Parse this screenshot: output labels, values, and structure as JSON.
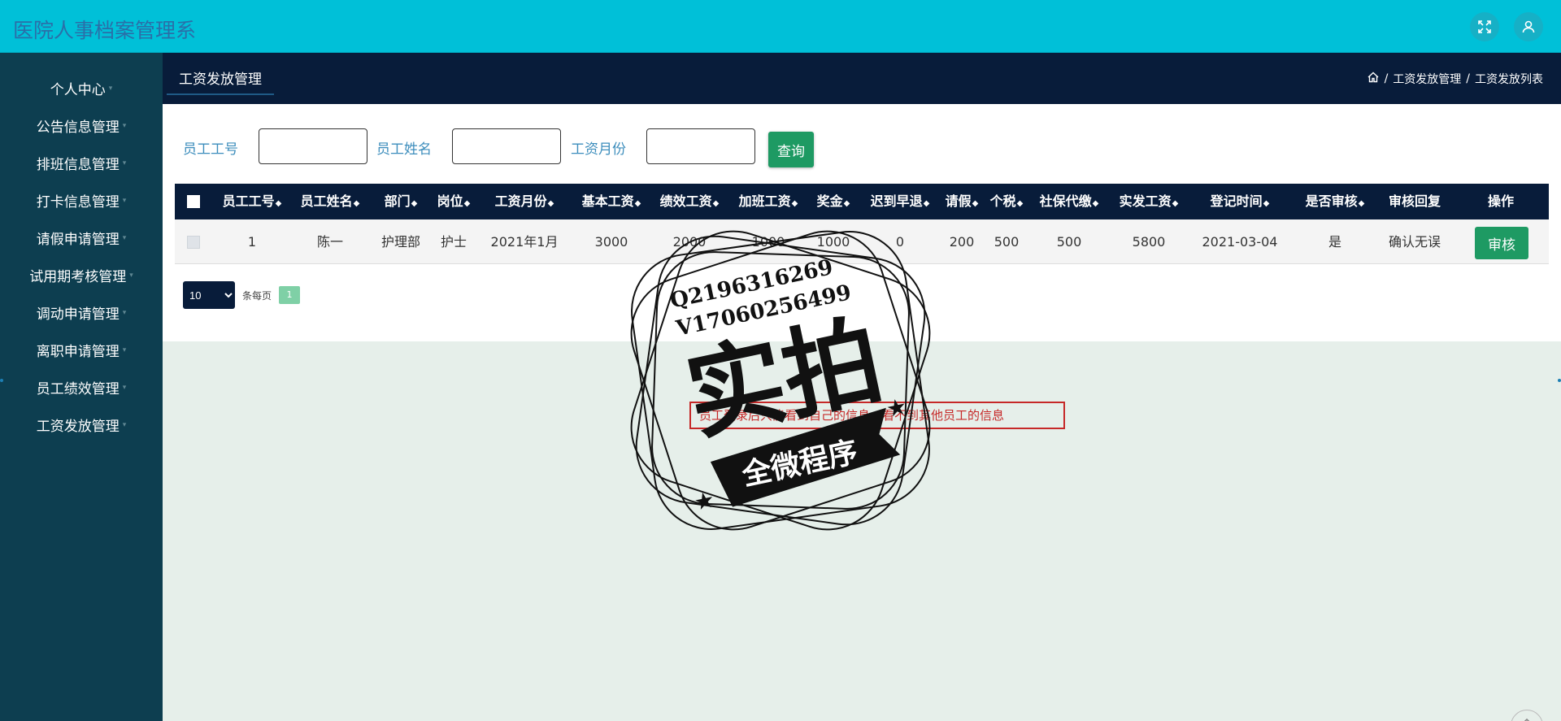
{
  "app": {
    "title": "医院人事档案管理系"
  },
  "sidebar": {
    "items": [
      {
        "label": "个人中心"
      },
      {
        "label": "公告信息管理"
      },
      {
        "label": "排班信息管理"
      },
      {
        "label": "打卡信息管理"
      },
      {
        "label": "请假申请管理"
      },
      {
        "label": "试用期考核管理"
      },
      {
        "label": "调动申请管理"
      },
      {
        "label": "离职申请管理"
      },
      {
        "label": "员工绩效管理"
      },
      {
        "label": "工资发放管理"
      }
    ]
  },
  "page": {
    "tab": "工资发放管理",
    "breadcrumb": [
      "工资发放管理",
      "工资发放列表"
    ],
    "separator": "/"
  },
  "search": {
    "fields": [
      {
        "label": "员工工号",
        "value": ""
      },
      {
        "label": "员工姓名",
        "value": ""
      },
      {
        "label": "工资月份",
        "value": ""
      }
    ],
    "button": "查询"
  },
  "table": {
    "columns": [
      "员工工号",
      "员工姓名",
      "部门",
      "岗位",
      "工资月份",
      "基本工资",
      "绩效工资",
      "加班工资",
      "奖金",
      "迟到早退",
      "请假",
      "个税",
      "社保代缴",
      "实发工资",
      "登记时间",
      "是否审核",
      "审核回复",
      "操作"
    ],
    "sortable": [
      true,
      true,
      true,
      true,
      true,
      true,
      true,
      true,
      true,
      true,
      true,
      true,
      true,
      true,
      true,
      true,
      false,
      false
    ],
    "rows": [
      [
        "1",
        "陈一",
        "护理部",
        "护士",
        "2021年1月",
        "3000",
        "2000",
        "1000",
        "1000",
        "0",
        "200",
        "500",
        "500",
        "5800",
        "2021-03-04",
        "是",
        "确认无误",
        "审核"
      ]
    ]
  },
  "pagination": {
    "page_size": "10",
    "per_page_label": "条每页",
    "current_page": "1"
  },
  "note": "员工登录后只能看到自己的信息，看不到其他员工的信息",
  "watermark": {
    "line1": "Q2196316269",
    "line2": "V17060256499",
    "big": "实拍",
    "ribbon": "全微程序"
  },
  "colors": {
    "topbar": "#00c0d8",
    "sidebar": "#0d3e50",
    "header": "#081c3a",
    "accent": "#1e9a63",
    "note": "#c62828"
  }
}
